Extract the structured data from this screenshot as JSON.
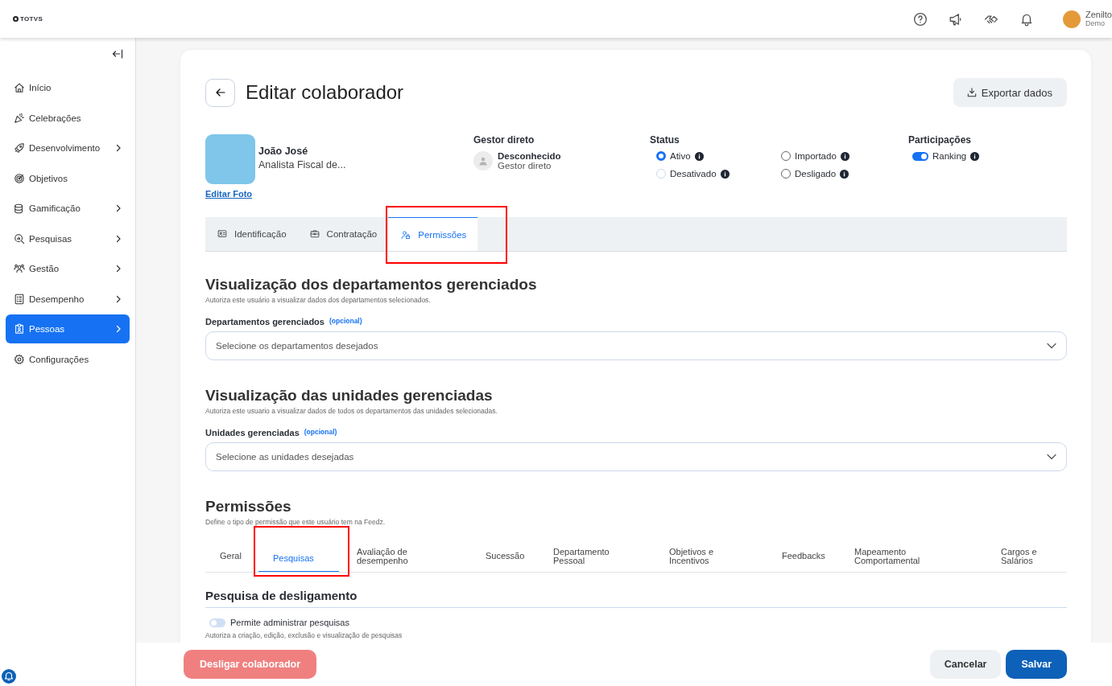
{
  "logo": {
    "text": "TOTVS"
  },
  "topbar": {
    "user": {
      "name": "Zenilto",
      "role": "Demo"
    }
  },
  "sidebar": {
    "items": [
      {
        "label": "Início",
        "has_submenu": false,
        "selected": false
      },
      {
        "label": "Celebrações",
        "has_submenu": false,
        "selected": false
      },
      {
        "label": "Desenvolvimento",
        "has_submenu": true,
        "selected": false
      },
      {
        "label": "Objetivos",
        "has_submenu": false,
        "selected": false
      },
      {
        "label": "Gamificação",
        "has_submenu": true,
        "selected": false
      },
      {
        "label": "Pesquisas",
        "has_submenu": true,
        "selected": false
      },
      {
        "label": "Gestão",
        "has_submenu": true,
        "selected": false
      },
      {
        "label": "Desempenho",
        "has_submenu": true,
        "selected": false
      },
      {
        "label": "Pessoas",
        "has_submenu": true,
        "selected": true
      },
      {
        "label": "Configurações",
        "has_submenu": false,
        "selected": false
      }
    ]
  },
  "page": {
    "title": "Editar colaborador",
    "export_button": "Exportar dados"
  },
  "profile": {
    "name": "João José",
    "role": "Analista Fiscal de...",
    "edit_photo": "Editar Foto"
  },
  "manager": {
    "heading": "Gestor direto",
    "name": "Desconhecido",
    "role": "Gestor direto"
  },
  "status": {
    "heading": "Status",
    "options": [
      {
        "label": "Ativo",
        "selected": true
      },
      {
        "label": "Importado",
        "selected": false
      },
      {
        "label": "Desativado",
        "selected": false,
        "disabled": true
      },
      {
        "label": "Desligado",
        "selected": false
      }
    ]
  },
  "participations": {
    "heading": "Participações",
    "items": [
      {
        "label": "Ranking",
        "on": true
      }
    ]
  },
  "tabs": [
    {
      "label": "Identificação",
      "selected": false,
      "highlighted": false
    },
    {
      "label": "Contratação",
      "selected": false,
      "highlighted": false
    },
    {
      "label": "Permissões",
      "selected": true,
      "highlighted": true
    }
  ],
  "sections": [
    {
      "title": "Visualização dos departamentos gerenciados",
      "description": "Autoriza este usuário a visualizar dados dos departamentos selecionados.",
      "field_label": "Departamentos gerenciados",
      "optional": "(opcional)",
      "placeholder": "Selecione os departamentos desejados"
    },
    {
      "title": "Visualização das unidades gerenciadas",
      "description": "Autoriza este usuario a visualizar dados de todos os departamentos das unidades selecionadas.",
      "field_label": "Unidades gerenciadas",
      "optional": "(opcional)",
      "placeholder": "Selecione as unidades desejadas"
    }
  ],
  "permissions": {
    "title": "Permissões",
    "description": "Define o tipo de permissão que este usuário tem na Feedz.",
    "tabs": [
      {
        "label": "Geral",
        "selected": false,
        "highlighted": false
      },
      {
        "label": "Pesquisas",
        "selected": true,
        "highlighted": true
      },
      {
        "label": "Avaliação de desempenho",
        "selected": false,
        "highlighted": false
      },
      {
        "label": "Sucessão",
        "selected": false,
        "highlighted": false
      },
      {
        "label": "Departamento Pessoal",
        "selected": false,
        "highlighted": false
      },
      {
        "label": "Objetivos e Incentivos",
        "selected": false,
        "highlighted": false
      },
      {
        "label": "Feedbacks",
        "selected": false,
        "highlighted": false
      },
      {
        "label": "Mapeamento Comportamental",
        "selected": false,
        "highlighted": false
      },
      {
        "label": "Cargos e Salários",
        "selected": false,
        "highlighted": false
      }
    ],
    "subsection": "Pesquisa de desligamento",
    "toggles": [
      {
        "label": "Permite administrar pesquisas",
        "on": false,
        "description": "Autoriza a criação, edição, exclusão e visualização de pesquisas"
      }
    ]
  },
  "footer": {
    "danger_button": "Desligar colaborador",
    "cancel_button": "Cancelar",
    "save_button": "Salvar"
  }
}
